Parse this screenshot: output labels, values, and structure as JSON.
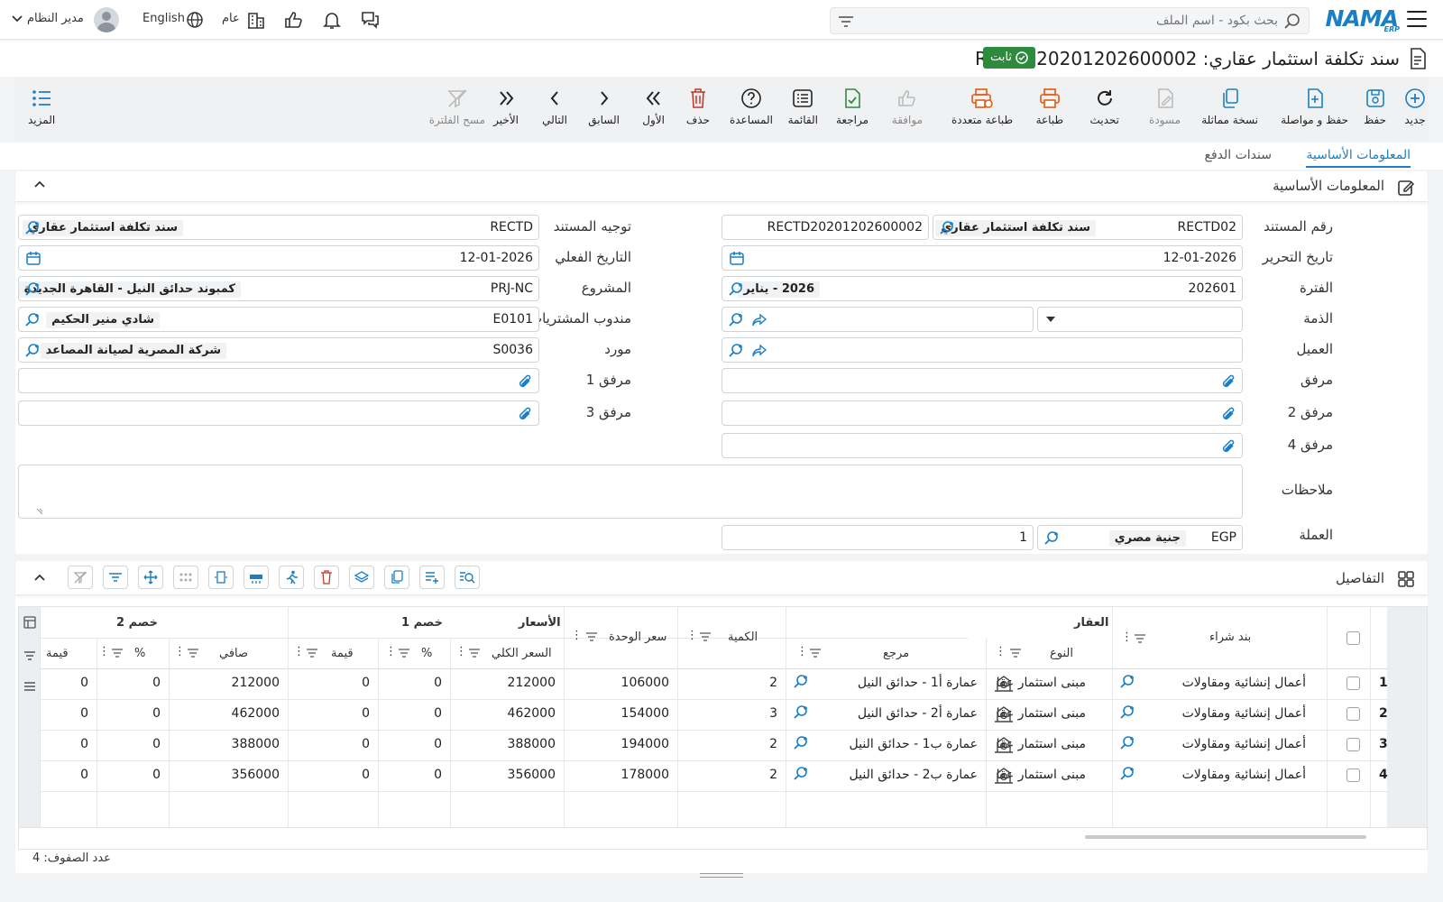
{
  "topbar": {
    "logo_main": "NAMA",
    "logo_sub": "ERP",
    "search_placeholder": "بحث بكود - اسم الملف",
    "company_label": "عام",
    "language_label": "English",
    "user_name": "مدير النظام"
  },
  "document": {
    "title": "سند تكلفة استثمار عقاري: RECTD20201202600002",
    "status_badge": "ثابت"
  },
  "toolbar": {
    "items": [
      {
        "label": "جديد",
        "icon": "plus-circle-icon"
      },
      {
        "label": "حفظ",
        "icon": "save-icon"
      },
      {
        "label": "حفظ و مواصلة",
        "icon": "save-continue-icon"
      },
      {
        "label": "نسخة مماثلة",
        "icon": "copy-icon"
      },
      {
        "label": "مسودة",
        "icon": "draft-icon"
      },
      {
        "label": "تحديث",
        "icon": "refresh-icon"
      },
      {
        "label": "طباعة",
        "icon": "print-icon"
      },
      {
        "label": "طباعة متعددة",
        "icon": "multi-print-icon"
      },
      {
        "label": "موافقة",
        "icon": "thumbs-up-icon"
      },
      {
        "label": "مراجعة",
        "icon": "review-icon"
      },
      {
        "label": "القائمة",
        "icon": "list-icon"
      },
      {
        "label": "المساعدة",
        "icon": "help-icon"
      },
      {
        "label": "حذف",
        "icon": "trash-icon"
      },
      {
        "label": "الأول",
        "icon": "first-icon"
      },
      {
        "label": "السابق",
        "icon": "previous-icon"
      },
      {
        "label": "التالي",
        "icon": "next-icon"
      },
      {
        "label": "الأخير",
        "icon": "last-icon"
      },
      {
        "label": "مسح الفلترة",
        "icon": "clear-filter-icon"
      }
    ],
    "more_label": "المزيد"
  },
  "tabs": [
    {
      "label": "المعلومات الأساسية",
      "active": true
    },
    {
      "label": "سندات الدفع",
      "active": false
    }
  ],
  "basic_info": {
    "section_title": "المعلومات الأساسية",
    "doc_number": {
      "label": "رقم المستند",
      "code": "RECTD02",
      "desc": "سند تكلفة استثمار عقاري",
      "number": "RECTD20201202600002"
    },
    "doc_direction": {
      "label": "توجيه المستند",
      "code": "RECTD",
      "desc": "سند تكلفة استثمار عقاري"
    },
    "issue_date": {
      "label": "تاريخ التحرير",
      "value": "12-01-2026"
    },
    "actual_date": {
      "label": "التاريخ الفعلي",
      "value": "12-01-2026"
    },
    "period": {
      "label": "الفترة",
      "code": "202601",
      "desc": "2026 - يناير"
    },
    "project": {
      "label": "المشروع",
      "code": "PRJ-NC",
      "desc": "كمبوند حدائق النيل - القاهرة الجديدة"
    },
    "liability": {
      "label": "الذمة"
    },
    "purchase_rep": {
      "label": "مندوب المشتريات",
      "code": "E0101",
      "desc": "شادي منير الحكيم"
    },
    "customer": {
      "label": "العميل"
    },
    "supplier": {
      "label": "مورد",
      "code": "S0036",
      "desc": "شركة المصرية لصيانة المصاعد"
    },
    "attachment": {
      "label": "مرفق"
    },
    "attachment1": {
      "label": "مرفق 1"
    },
    "attachment2": {
      "label": "مرفق 2"
    },
    "attachment3": {
      "label": "مرفق 3"
    },
    "attachment4": {
      "label": "مرفق 4"
    },
    "notes": {
      "label": "ملاحظات"
    },
    "currency": {
      "label": "العملة",
      "code": "EGP",
      "desc": "جنية مصري",
      "rate": "1"
    }
  },
  "details": {
    "section_title": "التفاصيل",
    "groups": {
      "property": "العقار",
      "prices": "الأسعار",
      "discount1": "خصم 1",
      "discount2": "خصم 2"
    },
    "columns": {
      "purchase_item": "بند شراء",
      "type": "النوع",
      "reference": "مرجع",
      "quantity": "الكمية",
      "unit_price": "سعر الوحدة",
      "total_price": "السعر الكلي",
      "d1_percent": "%",
      "d1_value": "قيمة",
      "net": "صافي",
      "d2_percent": "%",
      "d2_value": "قيمة"
    },
    "rows": [
      {
        "n": "1",
        "item": "أعمال إنشائية ومقاولات",
        "type": "مبنى استثمار عقا",
        "ref": "عمارة أ1 - حدائق النيل",
        "qty": "2",
        "unit": "106000",
        "total": "212000",
        "d1p": "0",
        "d1v": "0",
        "net": "212000",
        "d2p": "0",
        "d2v": "0"
      },
      {
        "n": "2",
        "item": "أعمال إنشائية ومقاولات",
        "type": "مبنى استثمار عقا",
        "ref": "عمارة أ2 - حدائق النيل",
        "qty": "3",
        "unit": "154000",
        "total": "462000",
        "d1p": "0",
        "d1v": "0",
        "net": "462000",
        "d2p": "0",
        "d2v": "0"
      },
      {
        "n": "3",
        "item": "أعمال إنشائية ومقاولات",
        "type": "مبنى استثمار عقا",
        "ref": "عمارة ب1 - حدائق النيل",
        "qty": "2",
        "unit": "194000",
        "total": "388000",
        "d1p": "0",
        "d1v": "0",
        "net": "388000",
        "d2p": "0",
        "d2v": "0"
      },
      {
        "n": "4",
        "item": "أعمال إنشائية ومقاولات",
        "type": "مبنى استثمار عقا",
        "ref": "عمارة ب2 - حدائق النيل",
        "qty": "2",
        "unit": "178000",
        "total": "356000",
        "d1p": "0",
        "d1v": "0",
        "net": "356000",
        "d2p": "0",
        "d2v": "0"
      }
    ],
    "row_count_label": "عدد الصفوف: 4"
  },
  "colors": {
    "accent": "#1a7fc4",
    "status_green": "#2e8b3d",
    "delete_red": "#c0392b",
    "print_orange": "#e8590c"
  }
}
